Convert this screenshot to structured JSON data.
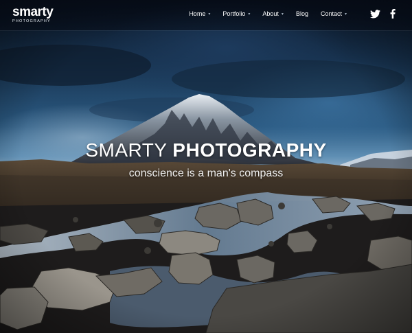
{
  "brand": {
    "name": "smarty",
    "subtitle": "PHOTOGRAPHY"
  },
  "nav": {
    "items": [
      {
        "label": "Home",
        "has_dropdown": true
      },
      {
        "label": "Portfolio",
        "has_dropdown": true
      },
      {
        "label": "About",
        "has_dropdown": true
      },
      {
        "label": "Blog",
        "has_dropdown": false
      },
      {
        "label": "Contact",
        "has_dropdown": true
      }
    ],
    "social": [
      "twitter-icon",
      "facebook-icon"
    ]
  },
  "hero": {
    "headline_light": "SMARTY",
    "headline_bold": "PHOTOGRAPHY",
    "tagline": "conscience is a man's compass"
  },
  "colors": {
    "text": "#ffffff",
    "navbar": "#050a14"
  }
}
